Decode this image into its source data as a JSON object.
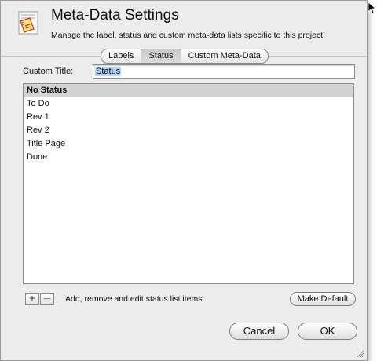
{
  "window": {
    "title": "Meta-Data Settings",
    "subtitle": "Manage the label, status and custom meta-data lists specific to this project."
  },
  "tabs": [
    {
      "label": "Labels",
      "active": false
    },
    {
      "label": "Status",
      "active": true
    },
    {
      "label": "Custom Meta-Data",
      "active": false
    }
  ],
  "custom_title": {
    "label": "Custom Title:",
    "value": "Status"
  },
  "status_list": [
    {
      "label": "No Status",
      "selected": true
    },
    {
      "label": "To Do",
      "selected": false
    },
    {
      "label": "Rev 1",
      "selected": false
    },
    {
      "label": "Rev 2",
      "selected": false
    },
    {
      "label": "Title Page",
      "selected": false
    },
    {
      "label": "Done",
      "selected": false
    }
  ],
  "list_controls": {
    "add_label": "+",
    "remove_label": "—",
    "hint": "Add, remove and edit status list items.",
    "make_default_label": "Make Default"
  },
  "footer": {
    "cancel_label": "Cancel",
    "ok_label": "OK"
  },
  "icons": {
    "app_icon": "tag-icon",
    "resize_grip": "resize-grip-icon",
    "cursor": "mouse-pointer-icon"
  },
  "colors": {
    "window_bg": "#ececec",
    "selected_row": "#d3d3d3",
    "text_selection": "#b5d5ff"
  }
}
